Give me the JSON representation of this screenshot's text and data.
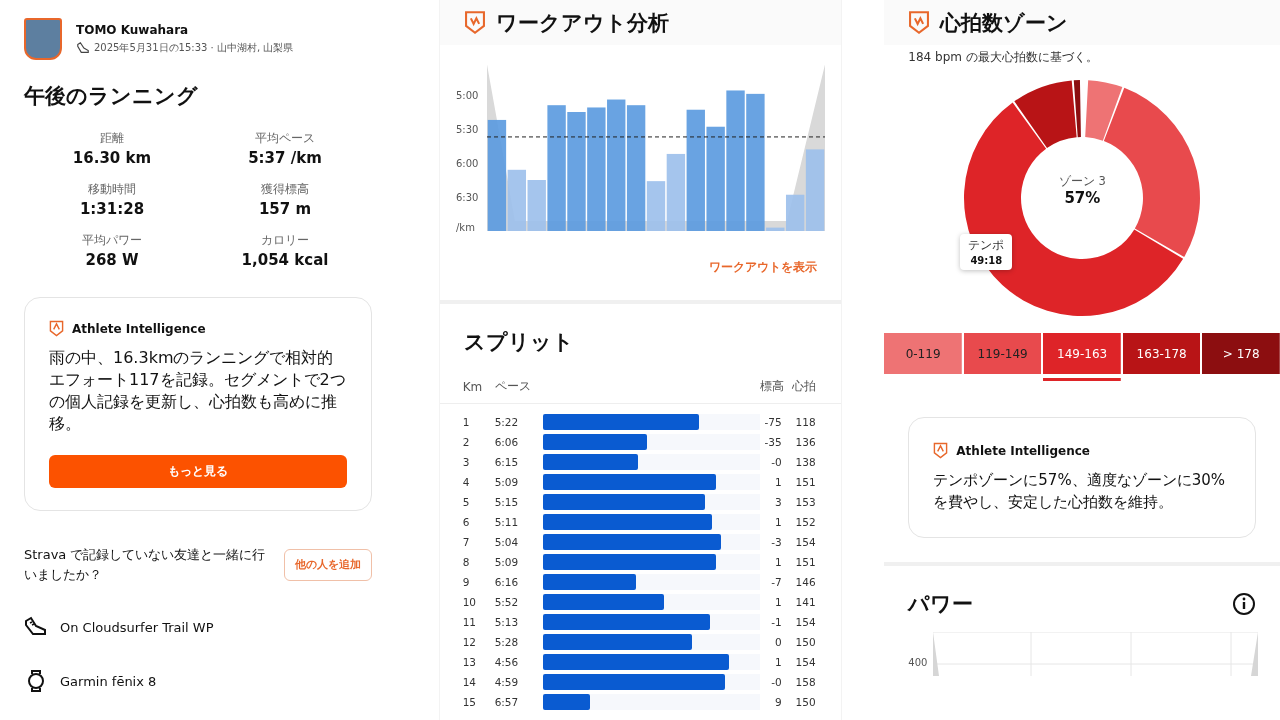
{
  "activity": {
    "athlete": "TOMO Kuwahara",
    "meta": "2025年5月31日の15:33 · 山中湖村, 山梨県",
    "title": "午後のランニング",
    "stats": [
      {
        "label": "距離",
        "value": "16.30 km"
      },
      {
        "label": "平均ペース",
        "value": "5:37 /km"
      },
      {
        "label": "移動時間",
        "value": "1:31:28"
      },
      {
        "label": "獲得標高",
        "value": "157 m"
      },
      {
        "label": "平均パワー",
        "value": "268 W"
      },
      {
        "label": "カロリー",
        "value": "1,054 kcal"
      }
    ],
    "ai_card": {
      "heading": "Athlete Intelligence",
      "text": "雨の中、16.3kmのランニングで相対的エフォート117を記録。セグメントで2つの個人記録を更新し、心拍数も高めに推移。",
      "button": "もっと見る"
    },
    "friends_prompt": {
      "text": "Strava で記録していない友達と一緒に行いましたか？",
      "button": "他の人を追加"
    },
    "gear": [
      {
        "kind": "shoe",
        "name": "On Cloudsurfer Trail WP"
      },
      {
        "kind": "watch",
        "name": "Garmin fēnix 8"
      }
    ]
  },
  "workout": {
    "title": "ワークアウト分析",
    "axis_labels": [
      "5:00",
      "5:30",
      "6:00",
      "6:30",
      "/km"
    ],
    "link": "ワークアウトを表示"
  },
  "splits": {
    "title": "スプリット",
    "columns": [
      "Km",
      "ペース",
      "標高",
      "心拍"
    ],
    "rows": [
      {
        "km": "1",
        "pace": "5:22",
        "level": 0.72,
        "elev": "-75",
        "hr": "118"
      },
      {
        "km": "2",
        "pace": "6:06",
        "level": 0.48,
        "elev": "-35",
        "hr": "136"
      },
      {
        "km": "3",
        "pace": "6:15",
        "level": 0.44,
        "elev": "-0",
        "hr": "138"
      },
      {
        "km": "4",
        "pace": "5:09",
        "level": 0.8,
        "elev": "1",
        "hr": "151"
      },
      {
        "km": "5",
        "pace": "5:15",
        "level": 0.75,
        "elev": "3",
        "hr": "153"
      },
      {
        "km": "6",
        "pace": "5:11",
        "level": 0.78,
        "elev": "1",
        "hr": "152"
      },
      {
        "km": "7",
        "pace": "5:04",
        "level": 0.82,
        "elev": "-3",
        "hr": "154"
      },
      {
        "km": "8",
        "pace": "5:09",
        "level": 0.8,
        "elev": "1",
        "hr": "151"
      },
      {
        "km": "9",
        "pace": "6:16",
        "level": 0.43,
        "elev": "-7",
        "hr": "146"
      },
      {
        "km": "10",
        "pace": "5:52",
        "level": 0.56,
        "elev": "1",
        "hr": "141"
      },
      {
        "km": "11",
        "pace": "5:13",
        "level": 0.77,
        "elev": "-1",
        "hr": "154"
      },
      {
        "km": "12",
        "pace": "5:28",
        "level": 0.69,
        "elev": "0",
        "hr": "150"
      },
      {
        "km": "13",
        "pace": "4:56",
        "level": 0.86,
        "elev": "1",
        "hr": "154"
      },
      {
        "km": "14",
        "pace": "4:59",
        "level": 0.84,
        "elev": "-0",
        "hr": "158"
      },
      {
        "km": "15",
        "pace": "6:57",
        "level": 0.22,
        "elev": "9",
        "hr": "150"
      }
    ]
  },
  "hr_zones": {
    "title": "心拍数ゾーン",
    "subtitle": "184 bpm の最大心拍数に基づく。",
    "center_label": "ゾーン 3",
    "center_value": "57%",
    "tooltip": {
      "label": "テンポ",
      "value": "49:18"
    },
    "zones": [
      {
        "range": "0-119",
        "color": "#ee7374",
        "selected": false
      },
      {
        "range": "119-149",
        "color": "#e84a4d",
        "selected": false
      },
      {
        "range": "149-163",
        "color": "#de2428",
        "selected": true
      },
      {
        "range": "163-178",
        "color": "#b81416",
        "selected": false
      },
      {
        "range": "> 178",
        "color": "#8c0e10",
        "selected": false
      }
    ],
    "ai_card": {
      "heading": "Athlete Intelligence",
      "text": "テンポゾーンに57%、適度なゾーンに30%を費やし、安定した心拍数を維持。"
    }
  },
  "power": {
    "title": "パワー",
    "y_tick": "400"
  }
}
